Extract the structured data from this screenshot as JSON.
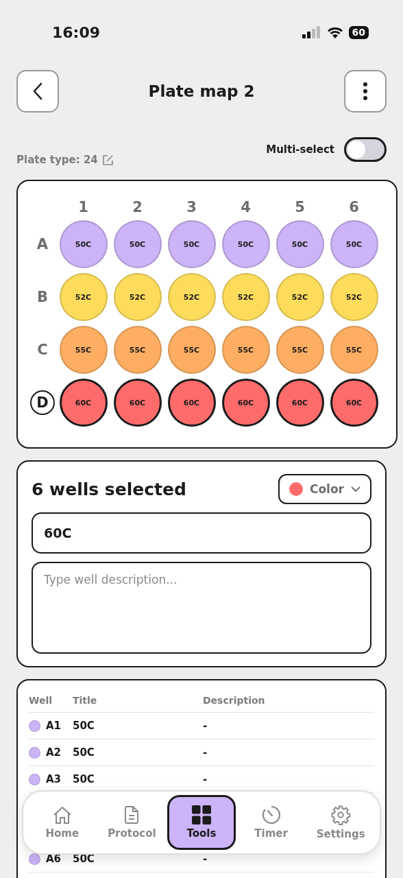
{
  "status_bar": {
    "time": "16:09",
    "battery": "60"
  },
  "header": {
    "title": "Plate map 2"
  },
  "plate_type": {
    "label": "Plate type: 24"
  },
  "multi_select": {
    "label": "Multi-select",
    "on": false
  },
  "plate": {
    "columns": [
      "1",
      "2",
      "3",
      "4",
      "5",
      "6"
    ],
    "rows": [
      {
        "label": "A",
        "selected": false,
        "wells": [
          {
            "title": "50C",
            "color": "#cdb3f7",
            "selected": false
          },
          {
            "title": "50C",
            "color": "#cdb3f7",
            "selected": false
          },
          {
            "title": "50C",
            "color": "#cdb3f7",
            "selected": false
          },
          {
            "title": "50C",
            "color": "#cdb3f7",
            "selected": false
          },
          {
            "title": "50C",
            "color": "#cdb3f7",
            "selected": false
          },
          {
            "title": "50C",
            "color": "#cdb3f7",
            "selected": false
          }
        ]
      },
      {
        "label": "B",
        "selected": false,
        "wells": [
          {
            "title": "52C",
            "color": "#fddc5c",
            "selected": false
          },
          {
            "title": "52C",
            "color": "#fddc5c",
            "selected": false
          },
          {
            "title": "52C",
            "color": "#fddc5c",
            "selected": false
          },
          {
            "title": "52C",
            "color": "#fddc5c",
            "selected": false
          },
          {
            "title": "52C",
            "color": "#fddc5c",
            "selected": false
          },
          {
            "title": "52C",
            "color": "#fddc5c",
            "selected": false
          }
        ]
      },
      {
        "label": "C",
        "selected": false,
        "wells": [
          {
            "title": "55C",
            "color": "#fdae62",
            "selected": false
          },
          {
            "title": "55C",
            "color": "#fdae62",
            "selected": false
          },
          {
            "title": "55C",
            "color": "#fdae62",
            "selected": false
          },
          {
            "title": "55C",
            "color": "#fdae62",
            "selected": false
          },
          {
            "title": "55C",
            "color": "#fdae62",
            "selected": false
          },
          {
            "title": "55C",
            "color": "#fdae62",
            "selected": false
          }
        ]
      },
      {
        "label": "D",
        "selected": true,
        "wells": [
          {
            "title": "60C",
            "color": "#fd6b6b",
            "selected": true
          },
          {
            "title": "60C",
            "color": "#fd6b6b",
            "selected": true
          },
          {
            "title": "60C",
            "color": "#fd6b6b",
            "selected": true
          },
          {
            "title": "60C",
            "color": "#fd6b6b",
            "selected": true
          },
          {
            "title": "60C",
            "color": "#fd6b6b",
            "selected": true
          },
          {
            "title": "60C",
            "color": "#fd6b6b",
            "selected": true
          }
        ]
      }
    ]
  },
  "selection": {
    "heading": "6 wells selected",
    "color_button": {
      "label": "Color",
      "color": "#fd6b6b"
    },
    "title_field": {
      "value": "60C"
    },
    "description_field": {
      "placeholder": "Type well description..."
    }
  },
  "table": {
    "columns": [
      "Well",
      "Title",
      "Description"
    ],
    "rows": [
      {
        "well": "A1",
        "title": "50C",
        "description": "-",
        "color": "#cdb3f7"
      },
      {
        "well": "A2",
        "title": "50C",
        "description": "-",
        "color": "#cdb3f7"
      },
      {
        "well": "A3",
        "title": "50C",
        "description": "-",
        "color": "#cdb3f7"
      },
      {
        "well": "A6",
        "title": "50C",
        "description": "-",
        "color": "#cdb3f7"
      }
    ]
  },
  "nav": [
    {
      "label": "Home",
      "kind": "home",
      "selected": false
    },
    {
      "label": "Protocol",
      "kind": "document",
      "selected": false
    },
    {
      "label": "Tools",
      "kind": "grid",
      "selected": true
    },
    {
      "label": "Timer",
      "kind": "timer",
      "selected": false
    },
    {
      "label": "Settings",
      "kind": "gear",
      "selected": false
    }
  ]
}
